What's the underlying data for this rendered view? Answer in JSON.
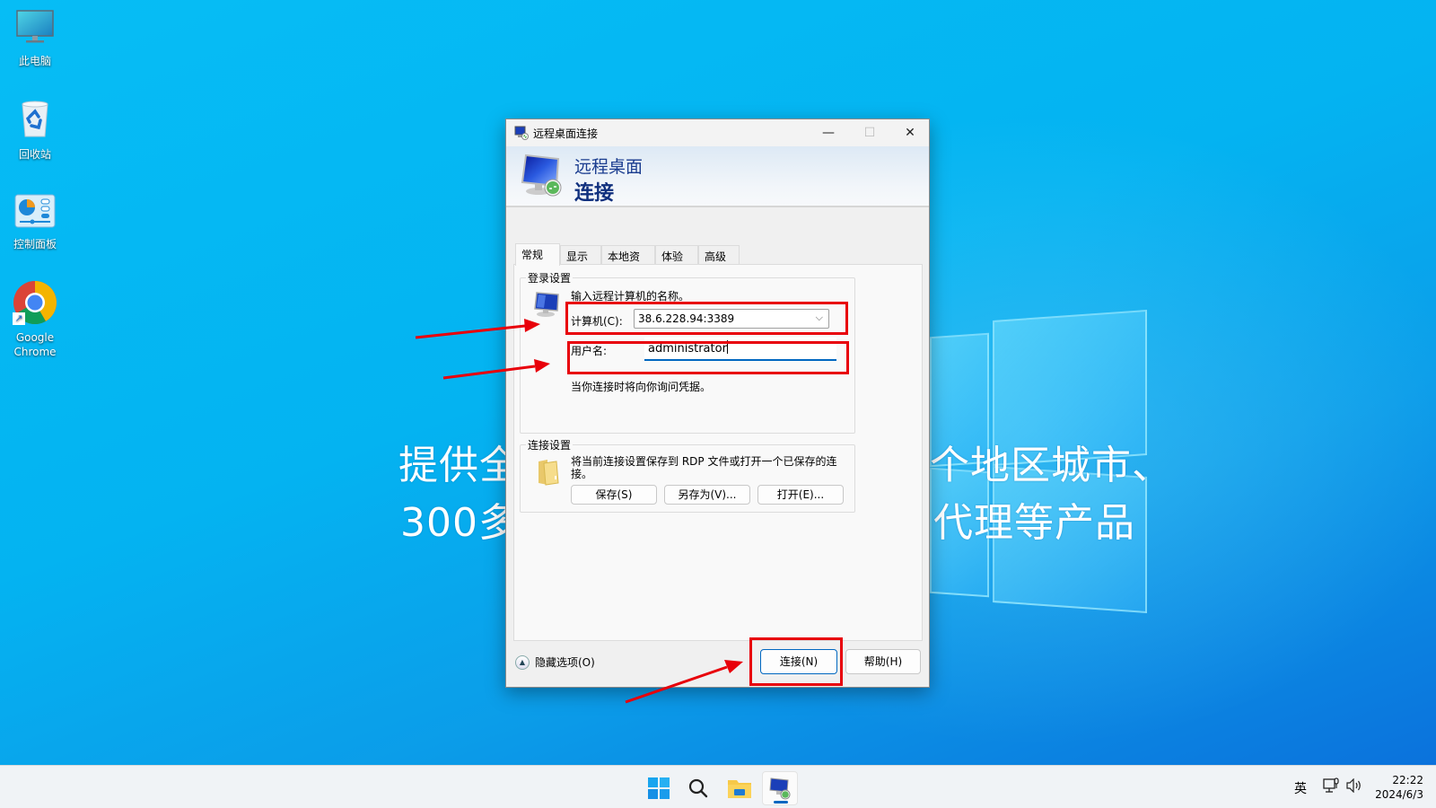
{
  "desktop": {
    "icons": [
      {
        "label": "此电脑",
        "icon": "this-pc-icon"
      },
      {
        "label": "回收站",
        "icon": "recycle-bin-icon"
      },
      {
        "label": "控制面板",
        "icon": "control-panel-icon"
      },
      {
        "label_line1": "Google",
        "label_line2": "Chrome",
        "icon": "chrome-icon"
      }
    ],
    "banner_line1_left": "提供全",
    "banner_line1_right": "个地区城市、",
    "banner_line2_left": "300多",
    "banner_line2_right": "代理等产品"
  },
  "dialog": {
    "window_title": "远程桌面连接",
    "header_line1": "远程桌面",
    "header_line2": "连接",
    "controls": {
      "minimize": "—",
      "maximize": "☐",
      "close": "✕"
    },
    "tabs": [
      {
        "label": "常规",
        "active": true
      },
      {
        "label": "显示",
        "active": false
      },
      {
        "label": "本地资源",
        "active": false
      },
      {
        "label": "体验",
        "active": false
      },
      {
        "label": "高级",
        "active": false
      }
    ],
    "logon_group": {
      "legend": "登录设置",
      "instruction": "输入远程计算机的名称。",
      "computer_label": "计算机(C):",
      "computer_value": "38.6.228.94:3389",
      "username_label": "用户名:",
      "username_value": "administrator",
      "note": "当你连接时将向你询问凭据。"
    },
    "connection_group": {
      "legend": "连接设置",
      "description_line1": "将当前连接设置保存到 RDP 文件或打开一个已保存的连",
      "description_line2": "接。",
      "save_label": "保存(S)",
      "save_as_label": "另存为(V)...",
      "open_label": "打开(E)..."
    },
    "hide_options_label": "隐藏选项(O)",
    "connect_label": "连接(N)",
    "help_label": "帮助(H)"
  },
  "annotations": {
    "highlight_color": "#e8000a"
  },
  "taskbar": {
    "apps": [
      "start-icon",
      "search-icon",
      "file-explorer-icon",
      "remote-desktop-icon"
    ],
    "ime": "英",
    "time": "22:22",
    "date": "2024/6/3"
  }
}
